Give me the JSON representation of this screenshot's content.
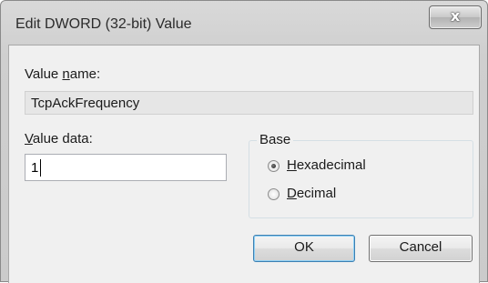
{
  "window": {
    "title": "Edit DWORD (32-bit) Value",
    "close_glyph": "x"
  },
  "value_name": {
    "label_pre": "Value ",
    "label_accel": "n",
    "label_post": "ame:",
    "value": "TcpAckFrequency"
  },
  "value_data": {
    "label_accel": "V",
    "label_post": "alue data:",
    "value": "1"
  },
  "base": {
    "title": "Base",
    "options": [
      {
        "label_accel": "H",
        "label_post": "exadecimal",
        "selected": true
      },
      {
        "label_accel": "D",
        "label_post": "ecimal",
        "selected": false
      }
    ]
  },
  "buttons": {
    "ok": "OK",
    "cancel": "Cancel"
  }
}
